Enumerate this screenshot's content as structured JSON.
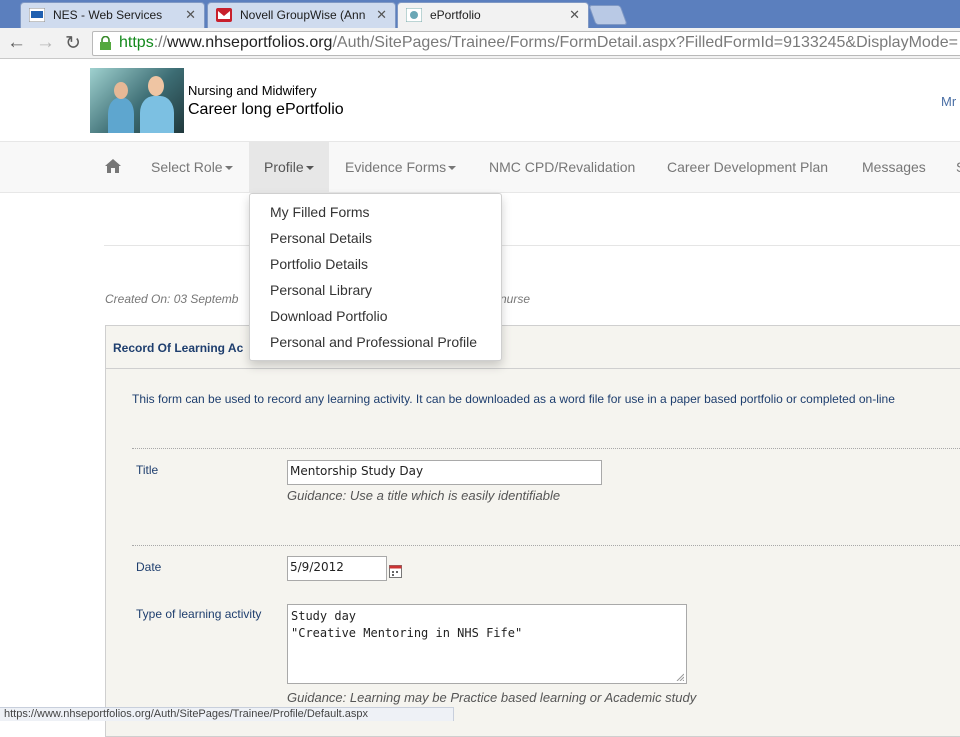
{
  "browser": {
    "tabs": [
      {
        "title": "NES - Web Services",
        "icon": "nhs-favicon"
      },
      {
        "title": "Novell GroupWise (Ann R",
        "icon": "groupwise-mail-favicon"
      },
      {
        "title": "ePortfolio",
        "icon": "eportfolio-favicon",
        "active": true
      }
    ],
    "url_scheme": "https",
    "url_sep": "://",
    "url_host": "www.nhseportfolios.org",
    "url_path": "/Auth/SitePages/Trainee/Forms/FormDetail.aspx?FilledFormId=9133245&DisplayMode=",
    "status_url": "https://www.nhseportfolios.org/Auth/SitePages/Trainee/Profile/Default.aspx"
  },
  "header": {
    "org_line": "Nursing and Midwifery",
    "app_title": "Career long ePortfolio",
    "user": "Mr"
  },
  "nav": {
    "home_icon": "home-icon",
    "items": [
      "Select Role",
      "Profile",
      "Evidence Forms",
      "NMC CPD/Revalidation",
      "Career Development Plan",
      "Messages",
      "S"
    ]
  },
  "profile_menu": [
    "My Filled Forms",
    "Personal Details",
    "Portfolio Details",
    "Personal Library",
    "Download Portfolio",
    "Personal and Professional Profile"
  ],
  "content": {
    "created_start": "Created On: 03 Septemb",
    "created_tail": "nurse",
    "panel_title": "Record Of Learning Ac",
    "intro": "This form can be used to record any learning activity. It can be downloaded as a word file for use in a paper based portfolio or completed on-line",
    "title_label": "Title",
    "title_value": "Mentorship Study Day",
    "title_guidance": "Guidance: Use a title which is easily identifiable",
    "date_label": "Date",
    "date_value": "5/9/2012",
    "type_label": "Type of learning activity",
    "type_line1": "Study day",
    "type_line2": "\"Creative Mentoring in NHS Fife\"",
    "type_guidance": "Guidance: Learning may be Practice based learning or Academic study"
  },
  "colors": {
    "tabbar": "#5b7fbe",
    "link": "#1e3e6e",
    "https_green": "#12891b"
  }
}
